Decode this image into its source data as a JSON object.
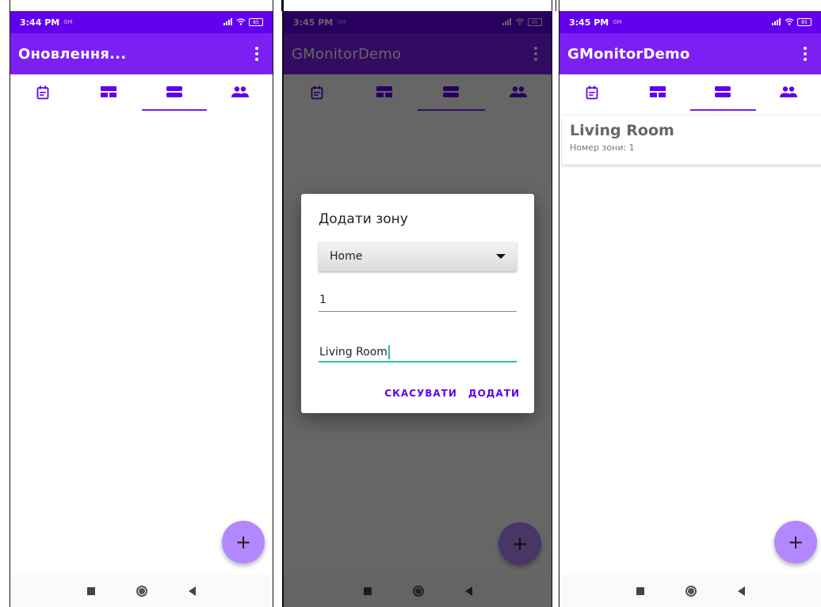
{
  "colors": {
    "status_bar": "#6200ee",
    "app_bar": "#7c1ff2",
    "tab_icon": "#6200ee",
    "fab": "#b388ff",
    "focus_accent": "#26bfa8"
  },
  "screens": [
    {
      "status": {
        "time": "3:44 PM",
        "carrier": "GM",
        "battery": "85"
      },
      "app_bar": {
        "title": "Оновлення..."
      }
    },
    {
      "status": {
        "time": "3:45 PM",
        "carrier": "GM",
        "battery": "85"
      },
      "app_bar": {
        "title": "GMonitorDemo"
      },
      "dialog": {
        "title": "Додати зону",
        "selected_home": "Home",
        "zone_number_value": "1",
        "zone_name_value": "Living Room",
        "cancel_label": "СКАСУВАТИ",
        "add_label": "ДОДАТИ"
      }
    },
    {
      "status": {
        "time": "3:45 PM",
        "carrier": "GM",
        "battery": "85"
      },
      "app_bar": {
        "title": "GMonitorDemo"
      },
      "zones": [
        {
          "name": "Living Room",
          "number_label": "Номер зони: 1"
        }
      ]
    }
  ],
  "tabs": [
    {
      "icon": "event-note-icon"
    },
    {
      "icon": "table-layout-icon"
    },
    {
      "icon": "view-agenda-icon",
      "active": true
    },
    {
      "icon": "people-icon"
    }
  ],
  "fab_label": "+",
  "nav": {
    "icons": [
      "recent-apps-icon",
      "home-icon",
      "back-icon"
    ]
  }
}
